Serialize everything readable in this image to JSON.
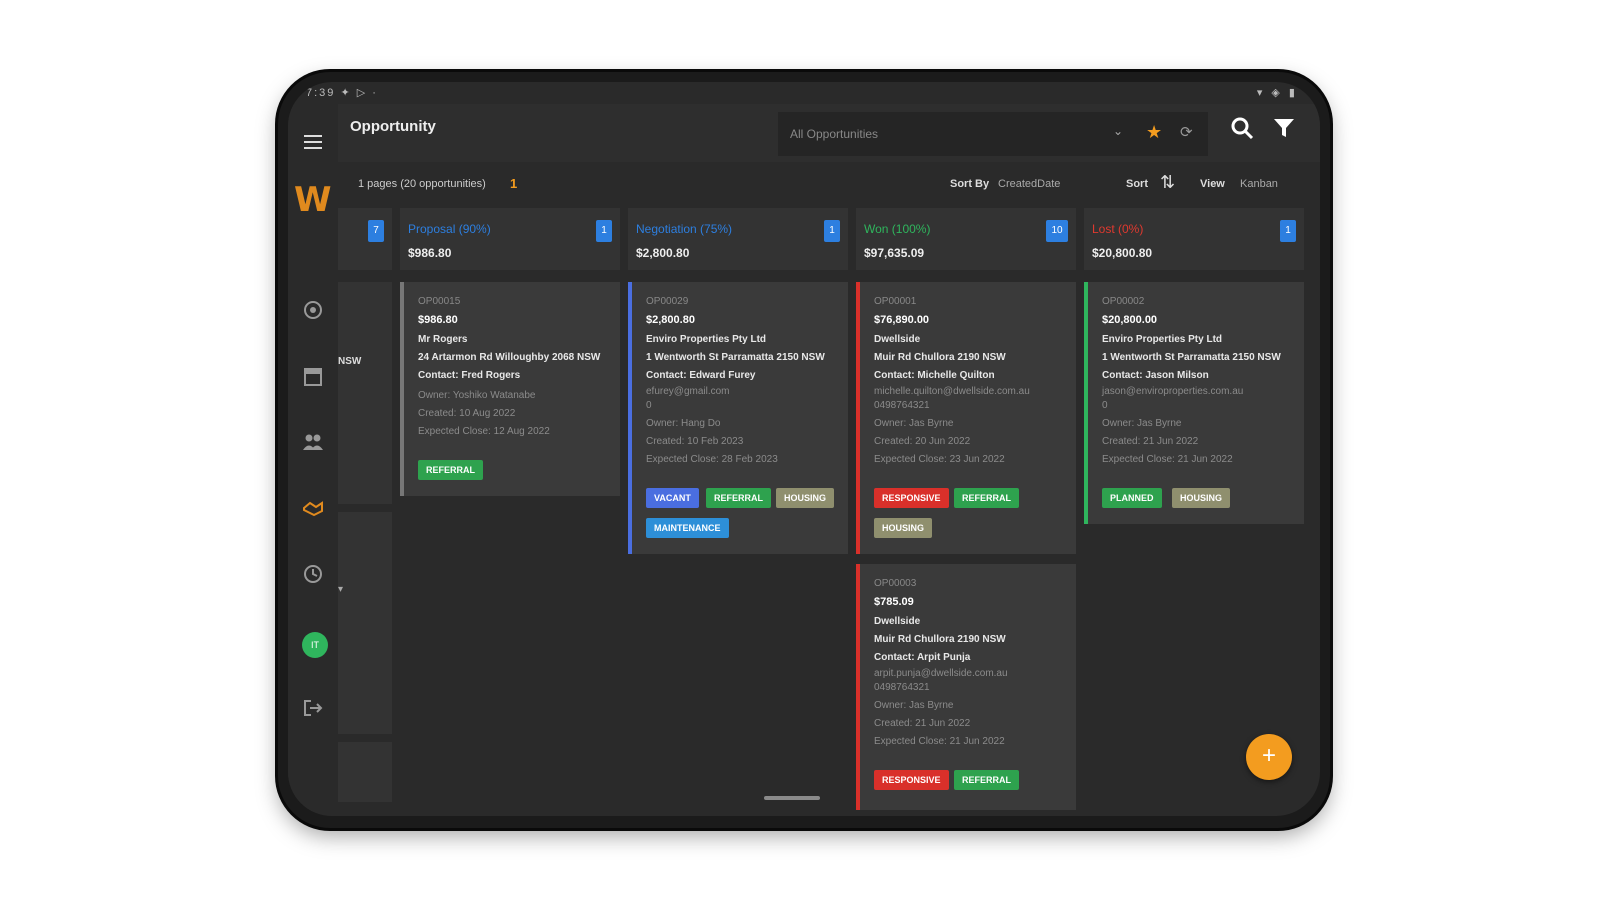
{
  "status": {
    "left": "7:39 ✦ ▷ ·",
    "right": "▾ ◈ ▮"
  },
  "app": {
    "title": "Opportunity"
  },
  "header": {
    "view_name": "All Opportunities",
    "caret": "⌄",
    "star": "★",
    "refresh": "⟳",
    "search_icon": "search-icon",
    "filter_icon": "filter-icon"
  },
  "subbar": {
    "pages_text": "1 pages (20 opportunities)",
    "page_number": "1",
    "sort_by_label": "Sort By",
    "sort_by_value": "CreatedDate",
    "sort_label": "Sort",
    "sort_icon": "⇅",
    "view_label": "View",
    "view_value": "Kanban"
  },
  "sidebar": {
    "logo": "W",
    "avatar": "IT",
    "icons": [
      "dashboard-icon",
      "calendar-icon",
      "contacts-icon",
      "opportunity-icon",
      "clock-icon",
      "logout-icon"
    ]
  },
  "partial_column": {
    "count": "7",
    "label": "NSW",
    "arrow": "▾"
  },
  "columns": [
    {
      "name": "Proposal (90%)",
      "color": "#2d7fe0",
      "amount": "$986.80",
      "count": "1"
    },
    {
      "name": "Negotiation (75%)",
      "color": "#2d7fe0",
      "amount": "$2,800.80",
      "count": "1"
    },
    {
      "name": "Won (100%)",
      "color": "#2fb55d",
      "amount": "$97,635.09",
      "count": "10"
    },
    {
      "name": "Lost (0%)",
      "color": "#e0392f",
      "amount": "$20,800.80",
      "count": "1"
    }
  ],
  "cards": [
    {
      "id": "OP00015",
      "amount": "$986.80",
      "company": "Mr Rogers",
      "address": "24 Artarmon Rd Willoughby 2068 NSW",
      "contact": "Contact: Fred Rogers",
      "email": "",
      "phone": "",
      "owner": "Owner: Yoshiko Watanabe",
      "created": "Created: 10 Aug 2022",
      "close": "Expected Close: 12 Aug 2022",
      "tags": [
        {
          "label": "REFERRAL",
          "color": "#2ea24e"
        }
      ]
    },
    {
      "id": "OP00029",
      "amount": "$2,800.80",
      "company": "Enviro Properties Pty Ltd",
      "address": "1 Wentworth St Parramatta 2150 NSW",
      "contact": "Contact: Edward Furey",
      "email": "efurey@gmail.com",
      "phone": "0",
      "owner": "Owner: Hang Do",
      "created": "Created: 10 Feb 2023",
      "close": "Expected Close: 28 Feb 2023",
      "tags": [
        {
          "label": "VACANT",
          "color": "#4a6ee0"
        },
        {
          "label": "REFERRAL",
          "color": "#2ea24e"
        },
        {
          "label": "HOUSING",
          "color": "#8f8f6e"
        },
        {
          "label": "MAINTENANCE",
          "color": "#2d8fd8"
        }
      ]
    },
    {
      "id": "OP00001",
      "amount": "$76,890.00",
      "company": "Dwellside",
      "address": "Muir Rd Chullora 2190 NSW",
      "contact": "Contact: Michelle Quilton",
      "email": "michelle.quilton@dwellside.com.au",
      "phone": "0498764321",
      "owner": "Owner: Jas Byrne",
      "created": "Created: 20 Jun 2022",
      "close": "Expected Close: 23 Jun 2022",
      "tags": [
        {
          "label": "RESPONSIVE",
          "color": "#d9302a"
        },
        {
          "label": "REFERRAL",
          "color": "#2ea24e"
        },
        {
          "label": "HOUSING",
          "color": "#8f8f6e"
        }
      ]
    },
    {
      "id": "OP00002",
      "amount": "$20,800.00",
      "company": "Enviro Properties Pty Ltd",
      "address": "1 Wentworth St Parramatta 2150 NSW",
      "contact": "Contact: Jason Milson",
      "email": "jason@enviroproperties.com.au",
      "phone": "0",
      "owner": "Owner: Jas Byrne",
      "created": "Created: 21 Jun 2022",
      "close": "Expected Close: 21 Jun 2022",
      "tags": [
        {
          "label": "PLANNED",
          "color": "#2ea24e"
        },
        {
          "label": "HOUSING",
          "color": "#8f8f6e"
        }
      ]
    },
    {
      "id": "OP00003",
      "amount": "$785.09",
      "company": "Dwellside",
      "address": "Muir Rd Chullora 2190 NSW",
      "contact": "Contact: Arpit Punja",
      "email": "arpit.punja@dwellside.com.au",
      "phone": "0498764321",
      "owner": "Owner: Jas Byrne",
      "created": "Created: 21 Jun 2022",
      "close": "Expected Close: 21 Jun 2022",
      "tags": [
        {
          "label": "RESPONSIVE",
          "color": "#d9302a"
        },
        {
          "label": "REFERRAL",
          "color": "#2ea24e"
        }
      ]
    }
  ],
  "fab": {
    "label": "+"
  }
}
